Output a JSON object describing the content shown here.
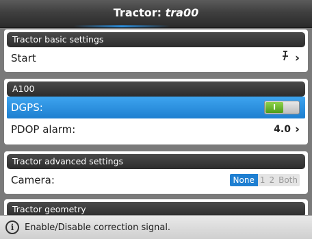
{
  "window": {
    "title_prefix": "Tractor:",
    "title_name": "tra00"
  },
  "sections": {
    "basic": {
      "title": "Tractor basic settings",
      "start_label": "Start",
      "start_icon": "pin-icon"
    },
    "a100": {
      "title": "A100",
      "dgps_label": "DGPS:",
      "dgps_toggle": "I",
      "dgps_on": true,
      "pdop_label": "PDOP alarm:",
      "pdop_value": "4.0"
    },
    "advanced": {
      "title": "Tractor advanced settings",
      "camera_label": "Camera:",
      "camera_options": [
        "None",
        "1",
        "2",
        "Both"
      ],
      "camera_selected": "None"
    },
    "geometry": {
      "title": "Tractor geometry"
    }
  },
  "status": {
    "text": "Enable/Disable correction signal."
  },
  "colors": {
    "accent": "#1f7fd1",
    "toggle_on": "#5aa821",
    "header": "#333333"
  }
}
